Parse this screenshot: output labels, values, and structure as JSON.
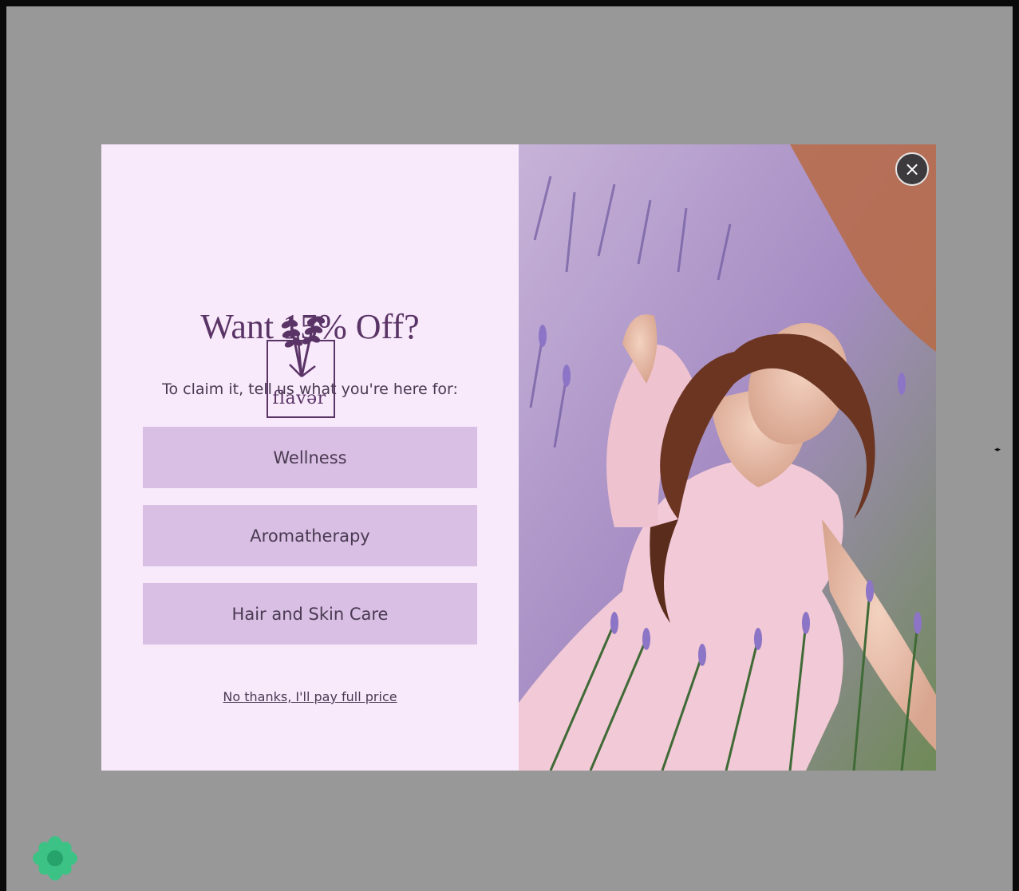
{
  "modal": {
    "logo": {
      "brand_text": "flavər"
    },
    "headline": "Want 15% Off?",
    "subline": "To claim it, tell us what you're here for:",
    "choices": [
      {
        "label": "Wellness"
      },
      {
        "label": "Aromatherapy"
      },
      {
        "label": "Hair and Skin Care"
      }
    ],
    "decline_link": "No thanks, I'll pay full price",
    "close_button": {
      "icon": "close-icon",
      "glyph": "×"
    }
  },
  "colors": {
    "overlay": "#989898",
    "panel_background": "#f8eafb",
    "accent_purple": "#5a3466",
    "choice_button": "#d8bfe3",
    "badge_green": "#3dc285"
  },
  "icons": [
    "lavender-logo-icon",
    "close-icon",
    "arrows-icon",
    "flower-badge-icon"
  ]
}
